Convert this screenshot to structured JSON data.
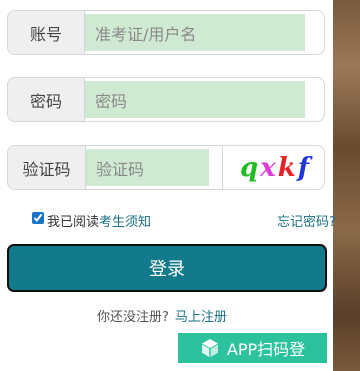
{
  "form": {
    "account": {
      "label": "账号",
      "placeholder": "准考证/用户名"
    },
    "password": {
      "label": "密码",
      "placeholder": "密码"
    },
    "captcha": {
      "label": "验证码",
      "placeholder": "验证码",
      "chars": [
        {
          "ch": "q",
          "color": "#22bb22"
        },
        {
          "ch": "x",
          "color": "#e03ad6"
        },
        {
          "ch": "k",
          "color": "#e5232b"
        },
        {
          "ch": "f",
          "color": "#2336d8"
        }
      ]
    }
  },
  "agreement": {
    "prefix": "我已阅读",
    "link": "考生须知",
    "checked": true
  },
  "forgot_password": "忘记密码?",
  "login_button": "登录",
  "register": {
    "prompt": "你还没注册?",
    "link": "马上注册"
  },
  "app_button": {
    "label": "APP扫码登",
    "icon": "cube-icon"
  }
}
